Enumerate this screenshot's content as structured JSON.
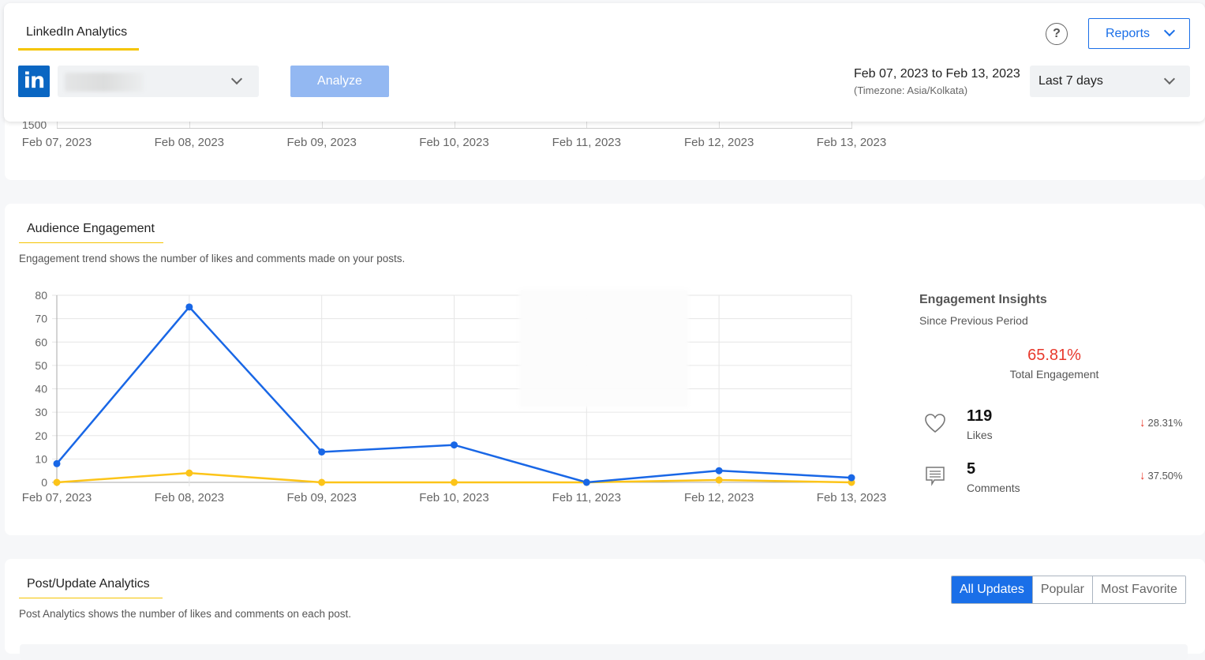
{
  "header": {
    "tab_title": "LinkedIn Analytics",
    "account_select": {
      "value": "",
      "icon": "chevron-down-icon"
    },
    "logo_text": "in",
    "analyze_label": "Analyze",
    "help_icon_glyph": "?",
    "reports_label": "Reports",
    "date_range": "Feb 07, 2023 to Feb 13, 2023",
    "timezone": "(Timezone: Asia/Kolkata)",
    "period_select": "Last 7 days"
  },
  "previous_chart": {
    "partial_y_label": "1500",
    "x_labels": [
      "Feb 07, 2023",
      "Feb 08, 2023",
      "Feb 09, 2023",
      "Feb 10, 2023",
      "Feb 11, 2023",
      "Feb 12, 2023",
      "Feb 13, 2023"
    ]
  },
  "engagement": {
    "title": "Audience Engagement",
    "description": "Engagement trend shows the number of likes and comments made on your posts.",
    "insights": {
      "title": "Engagement Insights",
      "subtitle": "Since Previous Period",
      "total_pct": "65.81%",
      "total_label": "Total Engagement",
      "metrics": [
        {
          "icon": "heart-icon",
          "value": "119",
          "label": "Likes",
          "change": "28.31%",
          "direction": "down"
        },
        {
          "icon": "comment-icon",
          "value": "5",
          "label": "Comments",
          "change": "37.50%",
          "direction": "down"
        }
      ]
    }
  },
  "posts": {
    "title": "Post/Update Analytics",
    "description": "Post Analytics shows the number of likes and comments on each post.",
    "filters": [
      {
        "label": "All Updates",
        "active": true
      },
      {
        "label": "Popular",
        "active": false
      },
      {
        "label": "Most Favorite",
        "active": false
      }
    ]
  },
  "colors": {
    "accent": "#1a6fe8",
    "highlight": "#f5c400",
    "negative": "#e8382b",
    "linkedin": "#0a66c2"
  },
  "chart_data": {
    "type": "line",
    "title": "",
    "xlabel": "",
    "ylabel": "",
    "categories": [
      "Feb 07, 2023",
      "Feb 08, 2023",
      "Feb 09, 2023",
      "Feb 10, 2023",
      "Feb 11, 2023",
      "Feb 12, 2023",
      "Feb 13, 2023"
    ],
    "ylim": [
      0,
      80
    ],
    "yticks": [
      0,
      10,
      20,
      30,
      40,
      50,
      60,
      70,
      80
    ],
    "grid": true,
    "legend": "none",
    "series": [
      {
        "name": "Likes",
        "color": "#1967e6",
        "values": [
          8,
          75,
          13,
          16,
          0,
          5,
          2
        ]
      },
      {
        "name": "Comments",
        "color": "#fcc419",
        "values": [
          0,
          4,
          0,
          0,
          0,
          1,
          0
        ]
      }
    ]
  }
}
